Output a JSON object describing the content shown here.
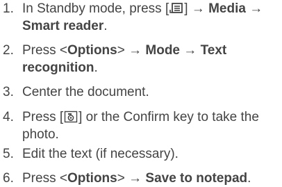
{
  "steps": [
    {
      "num": "1.",
      "a": "In Standby mode, press [",
      "icon": "menu-key-icon",
      "b": "] → ",
      "bold1": "Media",
      "c": " → ",
      "bold2": "Smart reader",
      "d": "."
    },
    {
      "num": "2.",
      "a": "Press <",
      "bold1": "Options",
      "b": "> → ",
      "bold2": "Mode",
      "c": " → ",
      "bold3": "Text recognition",
      "d": "."
    },
    {
      "num": "3.",
      "text": "Center the document."
    },
    {
      "num": "4.",
      "a": "Press [",
      "icon": "camera-key-icon",
      "b": "] or the Confirm key to take the photo."
    },
    {
      "num": "5.",
      "text": "Edit the text (if necessary)."
    },
    {
      "num": "6.",
      "a": "Press <",
      "bold1": "Options",
      "b": "> → ",
      "bold2": "Save to notepad",
      "c": "."
    }
  ],
  "colors": {
    "text": "#444444"
  }
}
